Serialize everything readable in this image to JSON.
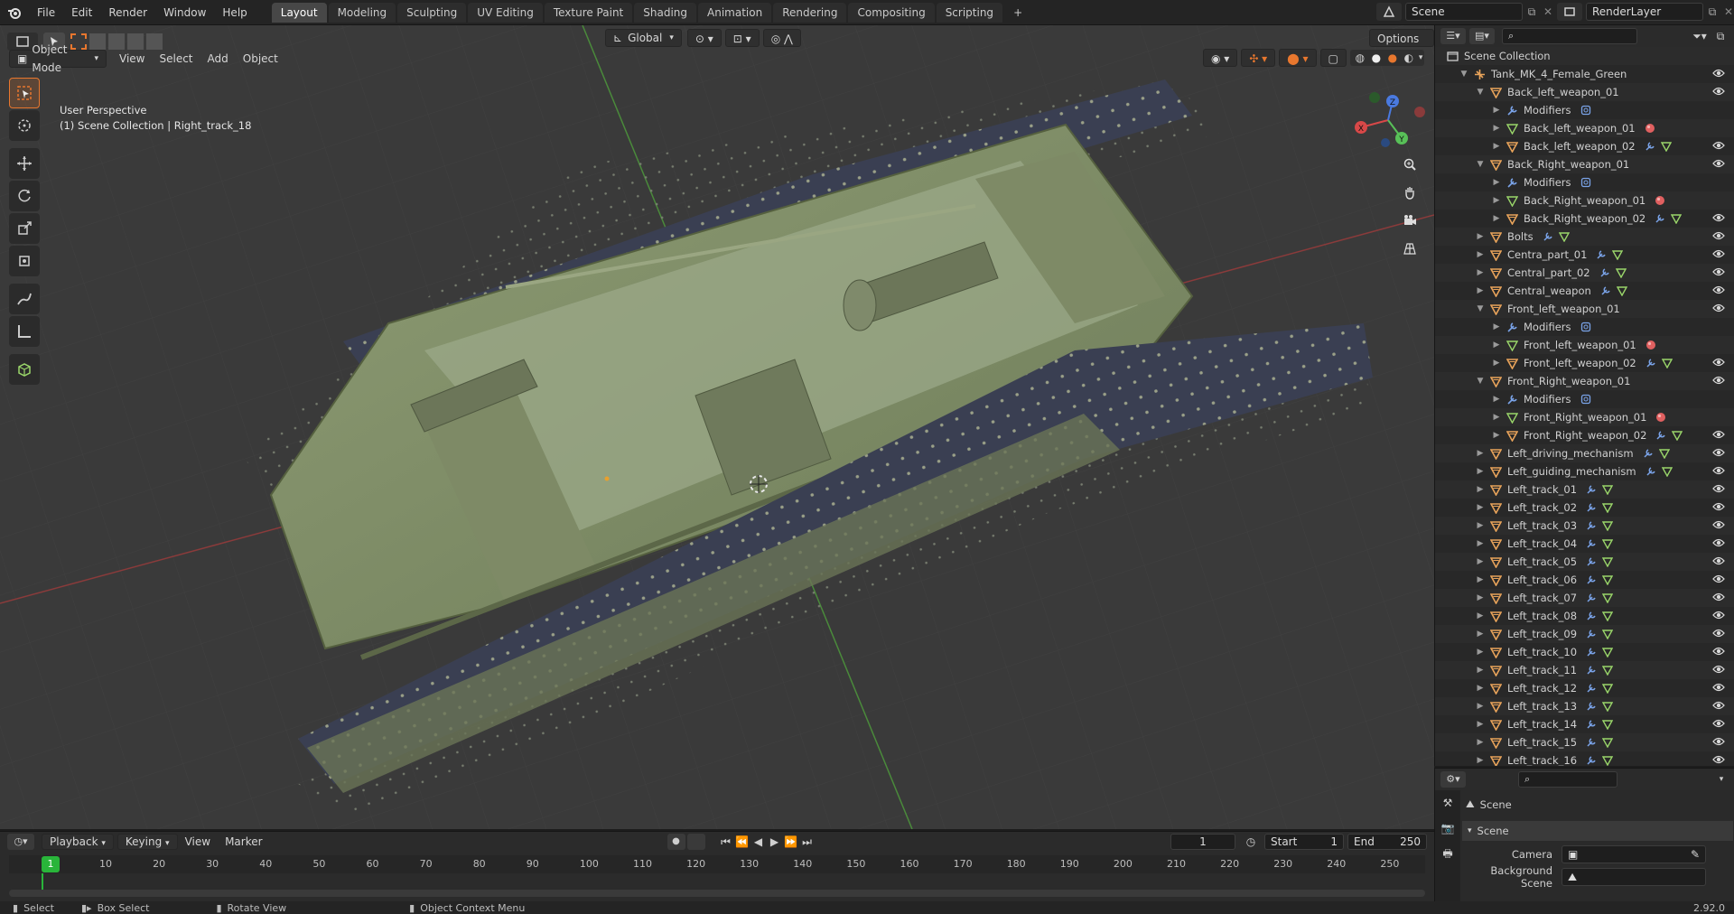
{
  "menubar": {
    "items": [
      "File",
      "Edit",
      "Render",
      "Window",
      "Help"
    ],
    "workspace_tabs": [
      "Layout",
      "Modeling",
      "Sculpting",
      "UV Editing",
      "Texture Paint",
      "Shading",
      "Animation",
      "Rendering",
      "Compositing",
      "Scripting"
    ],
    "active_tab": "Layout",
    "add_tab": "+",
    "scene_name": "Scene",
    "view_layer": "RenderLayer"
  },
  "viewport": {
    "mode": "Object Mode",
    "menus": [
      "View",
      "Select",
      "Add",
      "Object"
    ],
    "orientation": "Global",
    "options_label": "Options",
    "overlay_title": "User Perspective",
    "overlay_subtitle": "(1) Scene Collection | Right_track_18",
    "gizmo": {
      "x": "X",
      "y": "Y",
      "z": "Z"
    },
    "tools": [
      "select-box",
      "cursor",
      "move",
      "rotate",
      "scale",
      "transform",
      "annotate",
      "measure",
      "add-cube"
    ],
    "nav_buttons": [
      "zoom",
      "hand-pan",
      "camera-view",
      "perspective-grid"
    ]
  },
  "outliner": {
    "root": "Scene Collection",
    "rows": [
      {
        "label": "Tank_MK_4_Female_Green",
        "type": "empty",
        "depth": 1,
        "expand": "open",
        "eye": true
      },
      {
        "label": "Back_left_weapon_01",
        "type": "mesh",
        "depth": 2,
        "expand": "open",
        "eye": true
      },
      {
        "label": "Modifiers",
        "type": "modifier",
        "depth": 3,
        "expand": "closed",
        "eye": false,
        "badges": [
          "modifier"
        ]
      },
      {
        "label": "Back_left_weapon_01",
        "type": "mesh-data",
        "depth": 3,
        "expand": "closed",
        "eye": false,
        "badges": [
          "material"
        ]
      },
      {
        "label": "Back_left_weapon_02",
        "type": "mesh",
        "depth": 3,
        "expand": "closed",
        "eye": true,
        "badges": [
          "wrench",
          "mesh"
        ]
      },
      {
        "label": "Back_Right_weapon_01",
        "type": "mesh",
        "depth": 2,
        "expand": "open",
        "eye": true
      },
      {
        "label": "Modifiers",
        "type": "modifier",
        "depth": 3,
        "expand": "closed",
        "eye": false,
        "badges": [
          "modifier"
        ]
      },
      {
        "label": "Back_Right_weapon_01",
        "type": "mesh-data",
        "depth": 3,
        "expand": "closed",
        "eye": false,
        "badges": [
          "material"
        ]
      },
      {
        "label": "Back_Right_weapon_02",
        "type": "mesh",
        "depth": 3,
        "expand": "closed",
        "eye": true,
        "badges": [
          "wrench",
          "mesh"
        ]
      },
      {
        "label": "Bolts",
        "type": "mesh",
        "depth": 2,
        "expand": "closed",
        "eye": true,
        "badges": [
          "wrench",
          "mesh"
        ]
      },
      {
        "label": "Centra_part_01",
        "type": "mesh",
        "depth": 2,
        "expand": "closed",
        "eye": true,
        "badges": [
          "wrench",
          "mesh"
        ]
      },
      {
        "label": "Central_part_02",
        "type": "mesh",
        "depth": 2,
        "expand": "closed",
        "eye": true,
        "badges": [
          "wrench",
          "mesh"
        ]
      },
      {
        "label": "Central_weapon",
        "type": "mesh",
        "depth": 2,
        "expand": "closed",
        "eye": true,
        "badges": [
          "wrench",
          "mesh"
        ]
      },
      {
        "label": "Front_left_weapon_01",
        "type": "mesh",
        "depth": 2,
        "expand": "open",
        "eye": true
      },
      {
        "label": "Modifiers",
        "type": "modifier",
        "depth": 3,
        "expand": "closed",
        "eye": false,
        "badges": [
          "modifier"
        ]
      },
      {
        "label": "Front_left_weapon_01",
        "type": "mesh-data",
        "depth": 3,
        "expand": "closed",
        "eye": false,
        "badges": [
          "material"
        ]
      },
      {
        "label": "Front_left_weapon_02",
        "type": "mesh",
        "depth": 3,
        "expand": "closed",
        "eye": true,
        "badges": [
          "wrench",
          "mesh"
        ]
      },
      {
        "label": "Front_Right_weapon_01",
        "type": "mesh",
        "depth": 2,
        "expand": "open",
        "eye": true
      },
      {
        "label": "Modifiers",
        "type": "modifier",
        "depth": 3,
        "expand": "closed",
        "eye": false,
        "badges": [
          "modifier"
        ]
      },
      {
        "label": "Front_Right_weapon_01",
        "type": "mesh-data",
        "depth": 3,
        "expand": "closed",
        "eye": false,
        "badges": [
          "material"
        ]
      },
      {
        "label": "Front_Right_weapon_02",
        "type": "mesh",
        "depth": 3,
        "expand": "closed",
        "eye": true,
        "badges": [
          "wrench",
          "mesh"
        ]
      },
      {
        "label": "Left_driving_mechanism",
        "type": "mesh",
        "depth": 2,
        "expand": "closed",
        "eye": true,
        "badges": [
          "wrench",
          "mesh"
        ]
      },
      {
        "label": "Left_guiding_mechanism",
        "type": "mesh",
        "depth": 2,
        "expand": "closed",
        "eye": true,
        "badges": [
          "wrench",
          "mesh"
        ]
      },
      {
        "label": "Left_track_01",
        "type": "mesh",
        "depth": 2,
        "expand": "closed",
        "eye": true,
        "badges": [
          "wrench",
          "mesh"
        ]
      },
      {
        "label": "Left_track_02",
        "type": "mesh",
        "depth": 2,
        "expand": "closed",
        "eye": true,
        "badges": [
          "wrench",
          "mesh"
        ]
      },
      {
        "label": "Left_track_03",
        "type": "mesh",
        "depth": 2,
        "expand": "closed",
        "eye": true,
        "badges": [
          "wrench",
          "mesh"
        ]
      },
      {
        "label": "Left_track_04",
        "type": "mesh",
        "depth": 2,
        "expand": "closed",
        "eye": true,
        "badges": [
          "wrench",
          "mesh"
        ]
      },
      {
        "label": "Left_track_05",
        "type": "mesh",
        "depth": 2,
        "expand": "closed",
        "eye": true,
        "badges": [
          "wrench",
          "mesh"
        ]
      },
      {
        "label": "Left_track_06",
        "type": "mesh",
        "depth": 2,
        "expand": "closed",
        "eye": true,
        "badges": [
          "wrench",
          "mesh"
        ]
      },
      {
        "label": "Left_track_07",
        "type": "mesh",
        "depth": 2,
        "expand": "closed",
        "eye": true,
        "badges": [
          "wrench",
          "mesh"
        ]
      },
      {
        "label": "Left_track_08",
        "type": "mesh",
        "depth": 2,
        "expand": "closed",
        "eye": true,
        "badges": [
          "wrench",
          "mesh"
        ]
      },
      {
        "label": "Left_track_09",
        "type": "mesh",
        "depth": 2,
        "expand": "closed",
        "eye": true,
        "badges": [
          "wrench",
          "mesh"
        ]
      },
      {
        "label": "Left_track_10",
        "type": "mesh",
        "depth": 2,
        "expand": "closed",
        "eye": true,
        "badges": [
          "wrench",
          "mesh"
        ]
      },
      {
        "label": "Left_track_11",
        "type": "mesh",
        "depth": 2,
        "expand": "closed",
        "eye": true,
        "badges": [
          "wrench",
          "mesh"
        ]
      },
      {
        "label": "Left_track_12",
        "type": "mesh",
        "depth": 2,
        "expand": "closed",
        "eye": true,
        "badges": [
          "wrench",
          "mesh"
        ]
      },
      {
        "label": "Left_track_13",
        "type": "mesh",
        "depth": 2,
        "expand": "closed",
        "eye": true,
        "badges": [
          "wrench",
          "mesh"
        ]
      },
      {
        "label": "Left_track_14",
        "type": "mesh",
        "depth": 2,
        "expand": "closed",
        "eye": true,
        "badges": [
          "wrench",
          "mesh"
        ]
      },
      {
        "label": "Left_track_15",
        "type": "mesh",
        "depth": 2,
        "expand": "closed",
        "eye": true,
        "badges": [
          "wrench",
          "mesh"
        ]
      },
      {
        "label": "Left_track_16",
        "type": "mesh",
        "depth": 2,
        "expand": "closed",
        "eye": true,
        "badges": [
          "wrench",
          "mesh"
        ]
      }
    ]
  },
  "properties": {
    "breadcrumb": "Scene",
    "panel_title": "Scene",
    "fields": [
      {
        "label": "Camera",
        "value": ""
      },
      {
        "label": "Background Scene",
        "value": ""
      }
    ],
    "tabs": [
      "tool",
      "render",
      "output"
    ]
  },
  "timeline": {
    "menus": [
      "Playback",
      "Keying",
      "View",
      "Marker"
    ],
    "current_frame": "1",
    "start_label": "Start",
    "start_value": "1",
    "end_label": "End",
    "end_value": "250",
    "ruler_ticks": [
      "10",
      "20",
      "30",
      "40",
      "50",
      "60",
      "70",
      "80",
      "90",
      "100",
      "110",
      "120",
      "130",
      "140",
      "150",
      "160",
      "170",
      "180",
      "190",
      "200",
      "210",
      "220",
      "230",
      "240",
      "250"
    ],
    "playhead_label": "1"
  },
  "statusbar": {
    "select": "Select",
    "box_select": "Box Select",
    "rotate_view": "Rotate View",
    "context_menu": "Object Context Menu",
    "version": "2.92.0"
  },
  "colors": {
    "accent": "#e8772e",
    "active_tool": "#e8772e",
    "playhead": "#29b53a",
    "mesh_icon": "#e8a35a",
    "modifier_icon": "#7aa3e8",
    "material_icon": "#e06060",
    "data_icon": "#9ad66a"
  }
}
